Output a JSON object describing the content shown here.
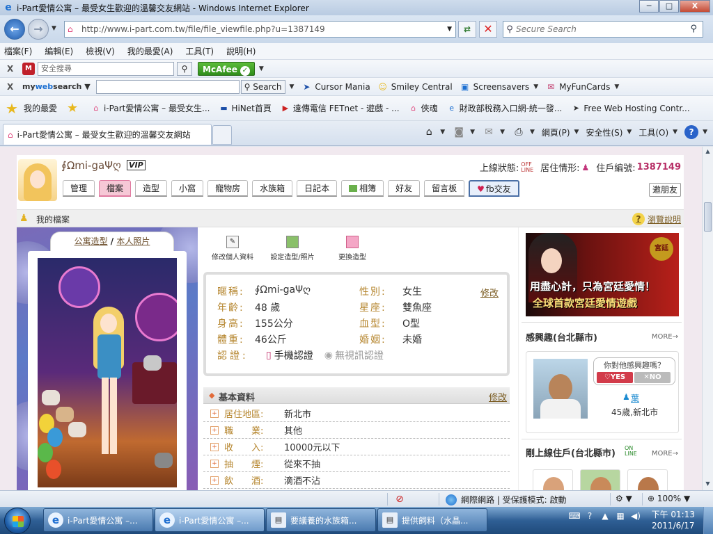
{
  "window": {
    "title": "i-Part愛情公寓 – 最受女生歡迎的溫馨交友網站 - Windows Internet Explorer",
    "min": "─",
    "max": "□",
    "close": "X"
  },
  "address": {
    "url": "http://www.i-part.com.tw/file/file_viewfile.php?u=1387149",
    "search_placeholder": "Secure Search"
  },
  "menubar": [
    "檔案(F)",
    "編輯(E)",
    "檢視(V)",
    "我的最愛(A)",
    "工具(T)",
    "說明(H)"
  ],
  "toolbar1": {
    "safe_search_placeholder": "安全搜尋",
    "mcafee": "McAfee"
  },
  "toolbar2": {
    "brand_prefix": "my",
    "brand_web": "web",
    "brand_suffix": "search",
    "search_button": "Search",
    "items": [
      "Cursor Mania",
      "Smiley Central",
      "Screensavers",
      "MyFunCards"
    ]
  },
  "favorites": {
    "label": "我的最愛",
    "links": [
      "i-Part愛情公寓 – 最受女生...",
      "HiNet首頁",
      "遠傳電信 FETnet - 遊戲 - ...",
      "俠魂",
      "財政部稅務入口網-統一發...",
      "Free Web Hosting Contr..."
    ]
  },
  "tab": {
    "title": "i-Part愛情公寓 – 最受女生歡迎的溫馨交友網站"
  },
  "commandbar": {
    "page": "網頁(P)",
    "safety": "安全性(S)",
    "tools": "工具(O)"
  },
  "profile": {
    "username": "∮Ωmi-gaΨღ",
    "vip": "VIP",
    "online_label": "上線狀態:",
    "offline_badge_1": "OFF",
    "offline_badge_2": "LINE",
    "residence_label": "居住情形:",
    "resident_no_label": "住戶編號:",
    "resident_no": "1387149",
    "nav": [
      "管理",
      "檔案",
      "造型",
      "小窩",
      "寵物房",
      "水族箱",
      "日記本",
      "相簿",
      "好友",
      "留言板",
      "fb交友"
    ],
    "invite": "邀朋友"
  },
  "section": {
    "title": "我的檔案",
    "help": "瀏覽說明"
  },
  "photo_tabs": {
    "avatar": "公寓造型",
    "sep": " / ",
    "real": "本人照片"
  },
  "actions": [
    "修改個人資料",
    "設定造型/照片",
    "更換造型"
  ],
  "info": {
    "edit": "修改",
    "rows": [
      {
        "k1": "暱稱:",
        "v1": "∮Ωmi-gaΨღ",
        "k2": "性別:",
        "v2": "女生"
      },
      {
        "k1": "年齡:",
        "v1": "48 歲",
        "k2": "星座:",
        "v2": "雙魚座"
      },
      {
        "k1": "身高:",
        "v1": "155公分",
        "k2": "血型:",
        "v2": "O型"
      },
      {
        "k1": "體重:",
        "v1": "46公斤",
        "k2": "婚姻:",
        "v2": "未婚"
      }
    ],
    "cert_label": "認證:",
    "cert_phone": "手機認證",
    "cert_video": "無視訊認證"
  },
  "basic": {
    "title": "基本資料",
    "edit": "修改",
    "rows": [
      {
        "k": "居住地區:",
        "v": "新北市"
      },
      {
        "k": "職　　業:",
        "v": "其他"
      },
      {
        "k": "收　　入:",
        "v": "10000元以下"
      },
      {
        "k": "抽　　煙:",
        "v": "從來不抽"
      },
      {
        "k": "飲　　酒:",
        "v": "滴酒不沾"
      }
    ]
  },
  "ad": {
    "line1": "用盡心計，只為宮廷愛情！",
    "line2": "全球首款宮廷愛情遊戲",
    "seal": "宮廷"
  },
  "right": {
    "interest_title": "感興趣(台北縣市)",
    "more": "MORE→",
    "question": "你對他感興趣嗎？",
    "yes": "♡YES",
    "no": "✕NO",
    "match_name": "葉",
    "match_meta": "45歲,新北市",
    "online_title": "剛上線住戶(台北縣市)",
    "online_badge_1": "ON",
    "online_badge_2": "LINE",
    "more2": "MORE→"
  },
  "statusbar": {
    "zone": "網際網路 | 受保護模式: 啟動",
    "zoom": "100%"
  },
  "taskbar": {
    "buttons": [
      "i-Part愛情公寓 –...",
      "i-Part愛情公寓 –...",
      "要議養的水族箱...",
      "提供飼料（水晶..."
    ],
    "time": "下午 01:13",
    "date": "2011/6/17"
  },
  "colors": {
    "accent": "#b72f67",
    "label": "#b5852d",
    "ie_blue": "#1c6fd1"
  }
}
